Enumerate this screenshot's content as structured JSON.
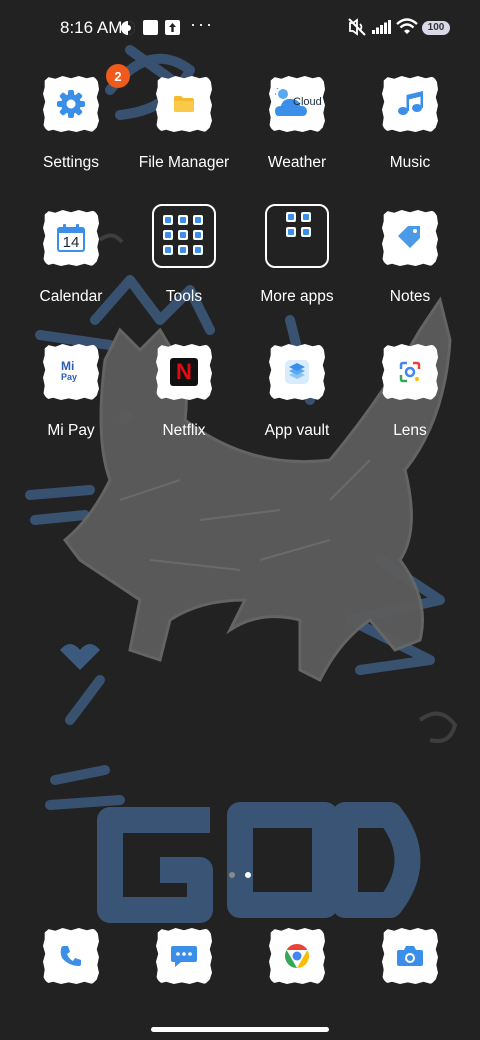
{
  "status_bar": {
    "time": "8:16 AM",
    "more": "···",
    "battery": "100",
    "icons": [
      "theme-icon",
      "square-notification-icon",
      "upload-notification-icon",
      "mute-icon",
      "signal-icon",
      "wifi-icon",
      "battery-icon"
    ]
  },
  "apps": {
    "settings": {
      "label": "Settings",
      "badge": "2"
    },
    "file_manager": {
      "label": "File Manager"
    },
    "weather": {
      "label": "Weather",
      "icon_text": "Cloud"
    },
    "music": {
      "label": "Music"
    },
    "calendar": {
      "label": "Calendar",
      "day": "14"
    },
    "tools": {
      "label": "Tools"
    },
    "more_apps": {
      "label": "More apps"
    },
    "notes": {
      "label": "Notes"
    },
    "mi_pay": {
      "label": "Mi Pay",
      "icon_top": "Mi",
      "icon_bottom": "Pay"
    },
    "netflix": {
      "label": "Netflix",
      "icon_letter": "N"
    },
    "app_vault": {
      "label": "App vault"
    },
    "lens": {
      "label": "Lens"
    }
  },
  "dock": [
    "phone",
    "messages",
    "chrome",
    "camera"
  ],
  "pages": {
    "count": 2,
    "current": 2
  },
  "colors": {
    "background": "#222222",
    "accent_blue": "#3b8fe8",
    "badge": "#f05a1a",
    "netflix_red": "#e50914",
    "wallpaper_blue": "#3c5a7e",
    "wallpaper_gray": "#5c5c5c"
  }
}
